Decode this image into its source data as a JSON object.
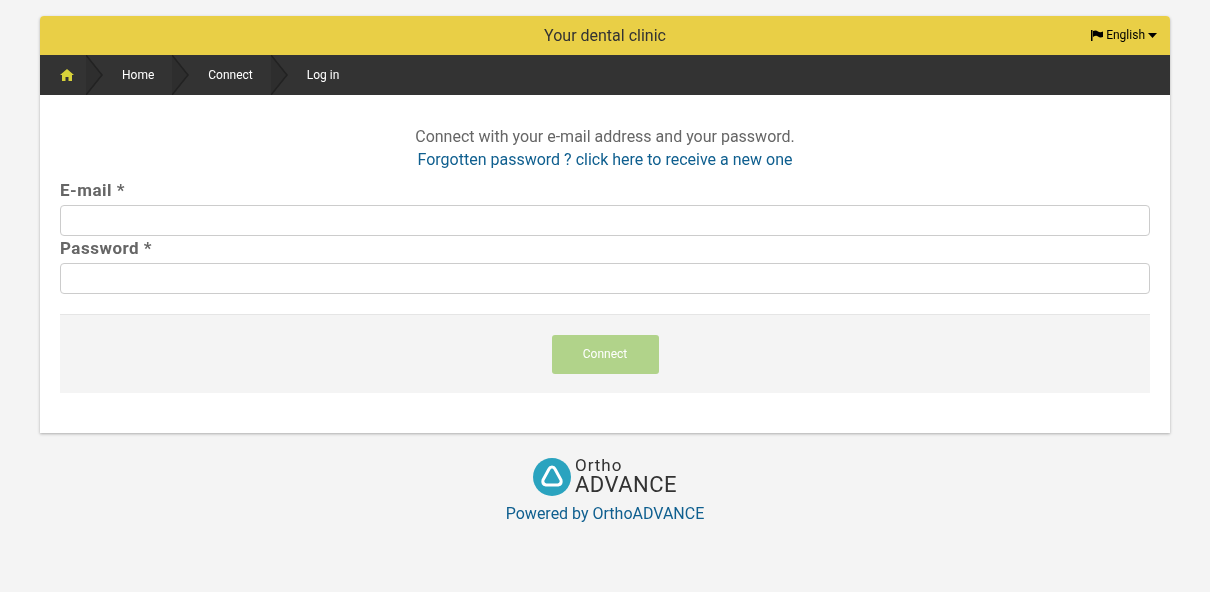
{
  "header": {
    "title": "Your dental clinic",
    "language": "English"
  },
  "breadcrumbs": [
    "Home",
    "Connect",
    "Log in"
  ],
  "intro": {
    "text": "Connect with your e-mail address and your password.",
    "link": "Forgotten password ? click here to receive a new one"
  },
  "fields": [
    {
      "label": "E-mail *"
    },
    {
      "label": "Password *"
    }
  ],
  "submit": {
    "label": "Connect",
    "disabled": true
  },
  "footer": {
    "logo_top": "Ortho",
    "logo_bottom": "ADVANCE",
    "powered": "Powered by OrthoADVANCE"
  }
}
